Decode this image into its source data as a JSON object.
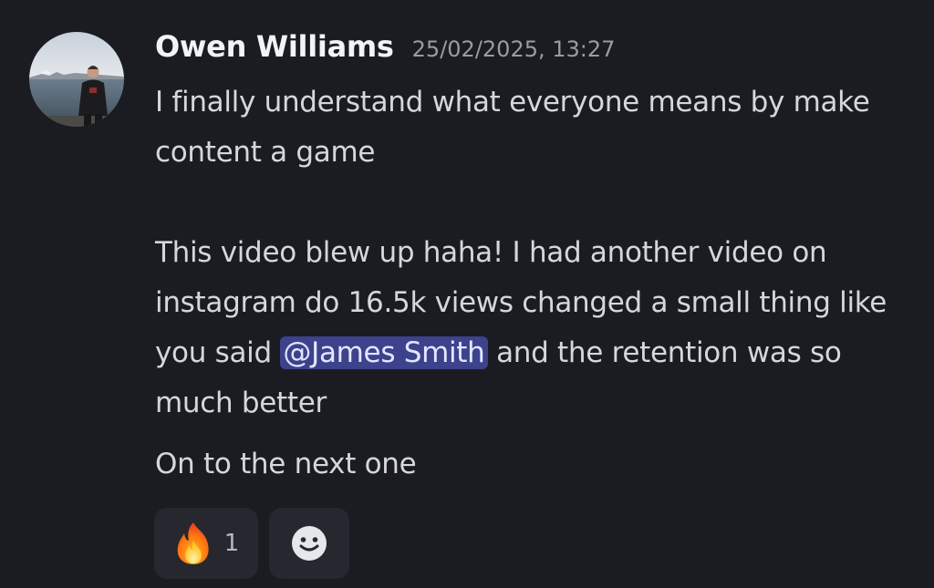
{
  "message": {
    "author": "Owen Williams",
    "timestamp": "25/02/2025, 13:27",
    "paragraphs": {
      "p1": "I finally understand what everyone means by make content a game",
      "p2_before_mention": "This video blew up haha! I had another video on instagram do 16.5k views changed a small thing like you said ",
      "mention": "@James Smith",
      "p2_after_mention": " and the retention was so much better",
      "p3": "On to the next one"
    },
    "reactions": [
      {
        "icon": "fire-emoji",
        "count": "1"
      },
      {
        "icon": "add-reaction-smiley-icon"
      }
    ]
  },
  "colors": {
    "background": "#1b1b22",
    "mention_bg": "#3c428c",
    "reaction_bg": "#26272f"
  }
}
